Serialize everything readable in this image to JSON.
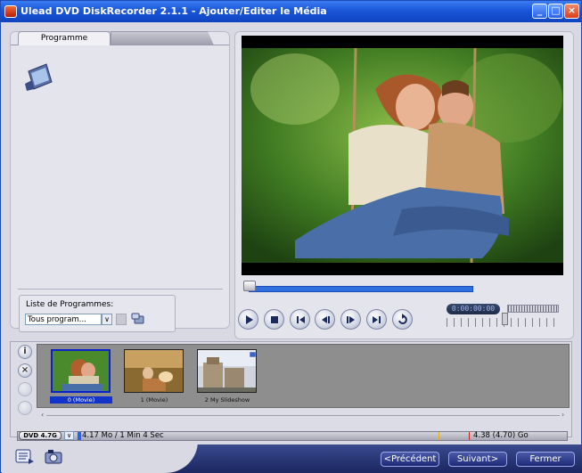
{
  "window": {
    "title": "Ulead DVD DiskRecorder 2.1.1 - Ajouter/Editer le Média"
  },
  "title_buttons": {
    "minimize": "_",
    "maximize": "□",
    "close": "×"
  },
  "left_panel": {
    "tabs": [
      {
        "label": "Programme",
        "active": true
      },
      {
        "label": "",
        "active": false
      }
    ],
    "program_list": {
      "label": "Liste de Programmes:",
      "selected": "Tous program...",
      "dropdown_arrow": "∨"
    }
  },
  "preview": {
    "timecode": "0:00:00:00",
    "controls": [
      "play",
      "stop",
      "previous",
      "step-back",
      "step-forward",
      "next",
      "repeat"
    ]
  },
  "storyboard": {
    "tools": [
      "i",
      "×",
      "",
      ""
    ],
    "items": [
      {
        "label": "0 (Movie)",
        "selected": true
      },
      {
        "label": "1 (Movie)",
        "selected": false
      },
      {
        "label": "2 My Slideshow",
        "selected": false
      }
    ]
  },
  "capacity": {
    "disc_type": "DVD 4.7G",
    "used": "4.17 Mo / 1 Min 4 Sec",
    "total": "4.38 (4.70) Go"
  },
  "footer": {
    "previous_label": "<Précédent",
    "next_label": "Suivant>",
    "close_label": "Fermer"
  },
  "colors": {
    "titlebar": "#1a56d8",
    "accent_blue": "#2f6fe0",
    "selection": "#1234c8"
  }
}
